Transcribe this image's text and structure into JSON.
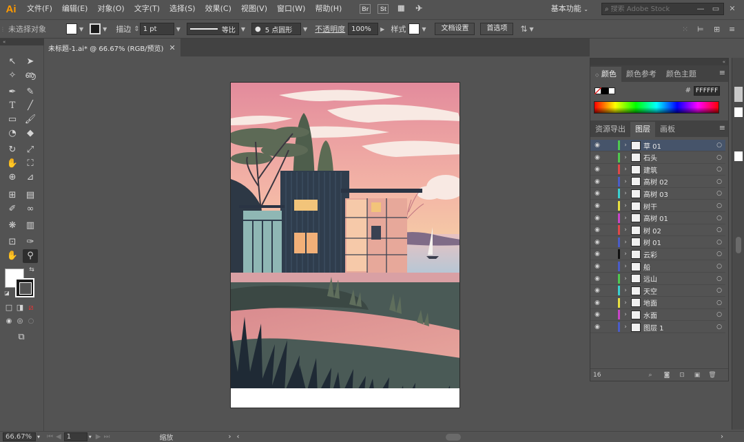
{
  "app": {
    "logo": "Ai"
  },
  "menubar": {
    "items": [
      "文件(F)",
      "编辑(E)",
      "对象(O)",
      "文字(T)",
      "选择(S)",
      "效果(C)",
      "视图(V)",
      "窗口(W)",
      "帮助(H)"
    ],
    "bridge_icon": "Br",
    "stock_icon": "St",
    "workspace": "基本功能",
    "search_placeholder": "搜索 Adobe Stock"
  },
  "controlbar": {
    "selection_label": "未选择对象",
    "stroke_label": "描边",
    "stroke_weight": "1 pt",
    "stroke_profile": "等比",
    "brush_label": "5 点圆形",
    "opacity_label": "不透明度",
    "opacity_value": "100%",
    "style_label": "样式",
    "doc_setup": "文档设置",
    "preferences": "首选项"
  },
  "document": {
    "tab_title": "未标题-1.ai* @ 66.67% (RGB/预览)"
  },
  "color_panel": {
    "tabs": [
      "颜色",
      "颜色参考",
      "颜色主题"
    ],
    "active_tab": "颜色",
    "hex_value": "FFFFFF",
    "hash": "#"
  },
  "layers_panel": {
    "tabs": [
      "资源导出",
      "图层",
      "画板"
    ],
    "active_tab": "图层",
    "layers": [
      {
        "name": "草 01",
        "color": "#4fc84f",
        "selected": true
      },
      {
        "name": "石头",
        "color": "#4fc84f",
        "selected": false
      },
      {
        "name": "建筑",
        "color": "#e04848",
        "selected": false
      },
      {
        "name": "高树 02",
        "color": "#4a5cc8",
        "selected": false
      },
      {
        "name": "高树 03",
        "color": "#3ad0d0",
        "selected": false
      },
      {
        "name": "树干",
        "color": "#e8e040",
        "selected": false
      },
      {
        "name": "高树 01",
        "color": "#c844c8",
        "selected": false
      },
      {
        "name": "树 02",
        "color": "#e04848",
        "selected": false
      },
      {
        "name": "树 01",
        "color": "#4a5cc8",
        "selected": false
      },
      {
        "name": "云彩",
        "color": "#111111",
        "selected": false
      },
      {
        "name": "船",
        "color": "#4a5cc8",
        "selected": false
      },
      {
        "name": "远山",
        "color": "#4fc84f",
        "selected": false
      },
      {
        "name": "天空",
        "color": "#3ad0d0",
        "selected": false
      },
      {
        "name": "地面",
        "color": "#e8e040",
        "selected": false
      },
      {
        "name": "水面",
        "color": "#c844c8",
        "selected": false
      },
      {
        "name": "图层 1",
        "color": "#4a5cc8",
        "selected": false
      }
    ],
    "count": "16"
  },
  "statusbar": {
    "zoom": "66.67%",
    "artboard_number": "1",
    "status_text": "缩放"
  }
}
